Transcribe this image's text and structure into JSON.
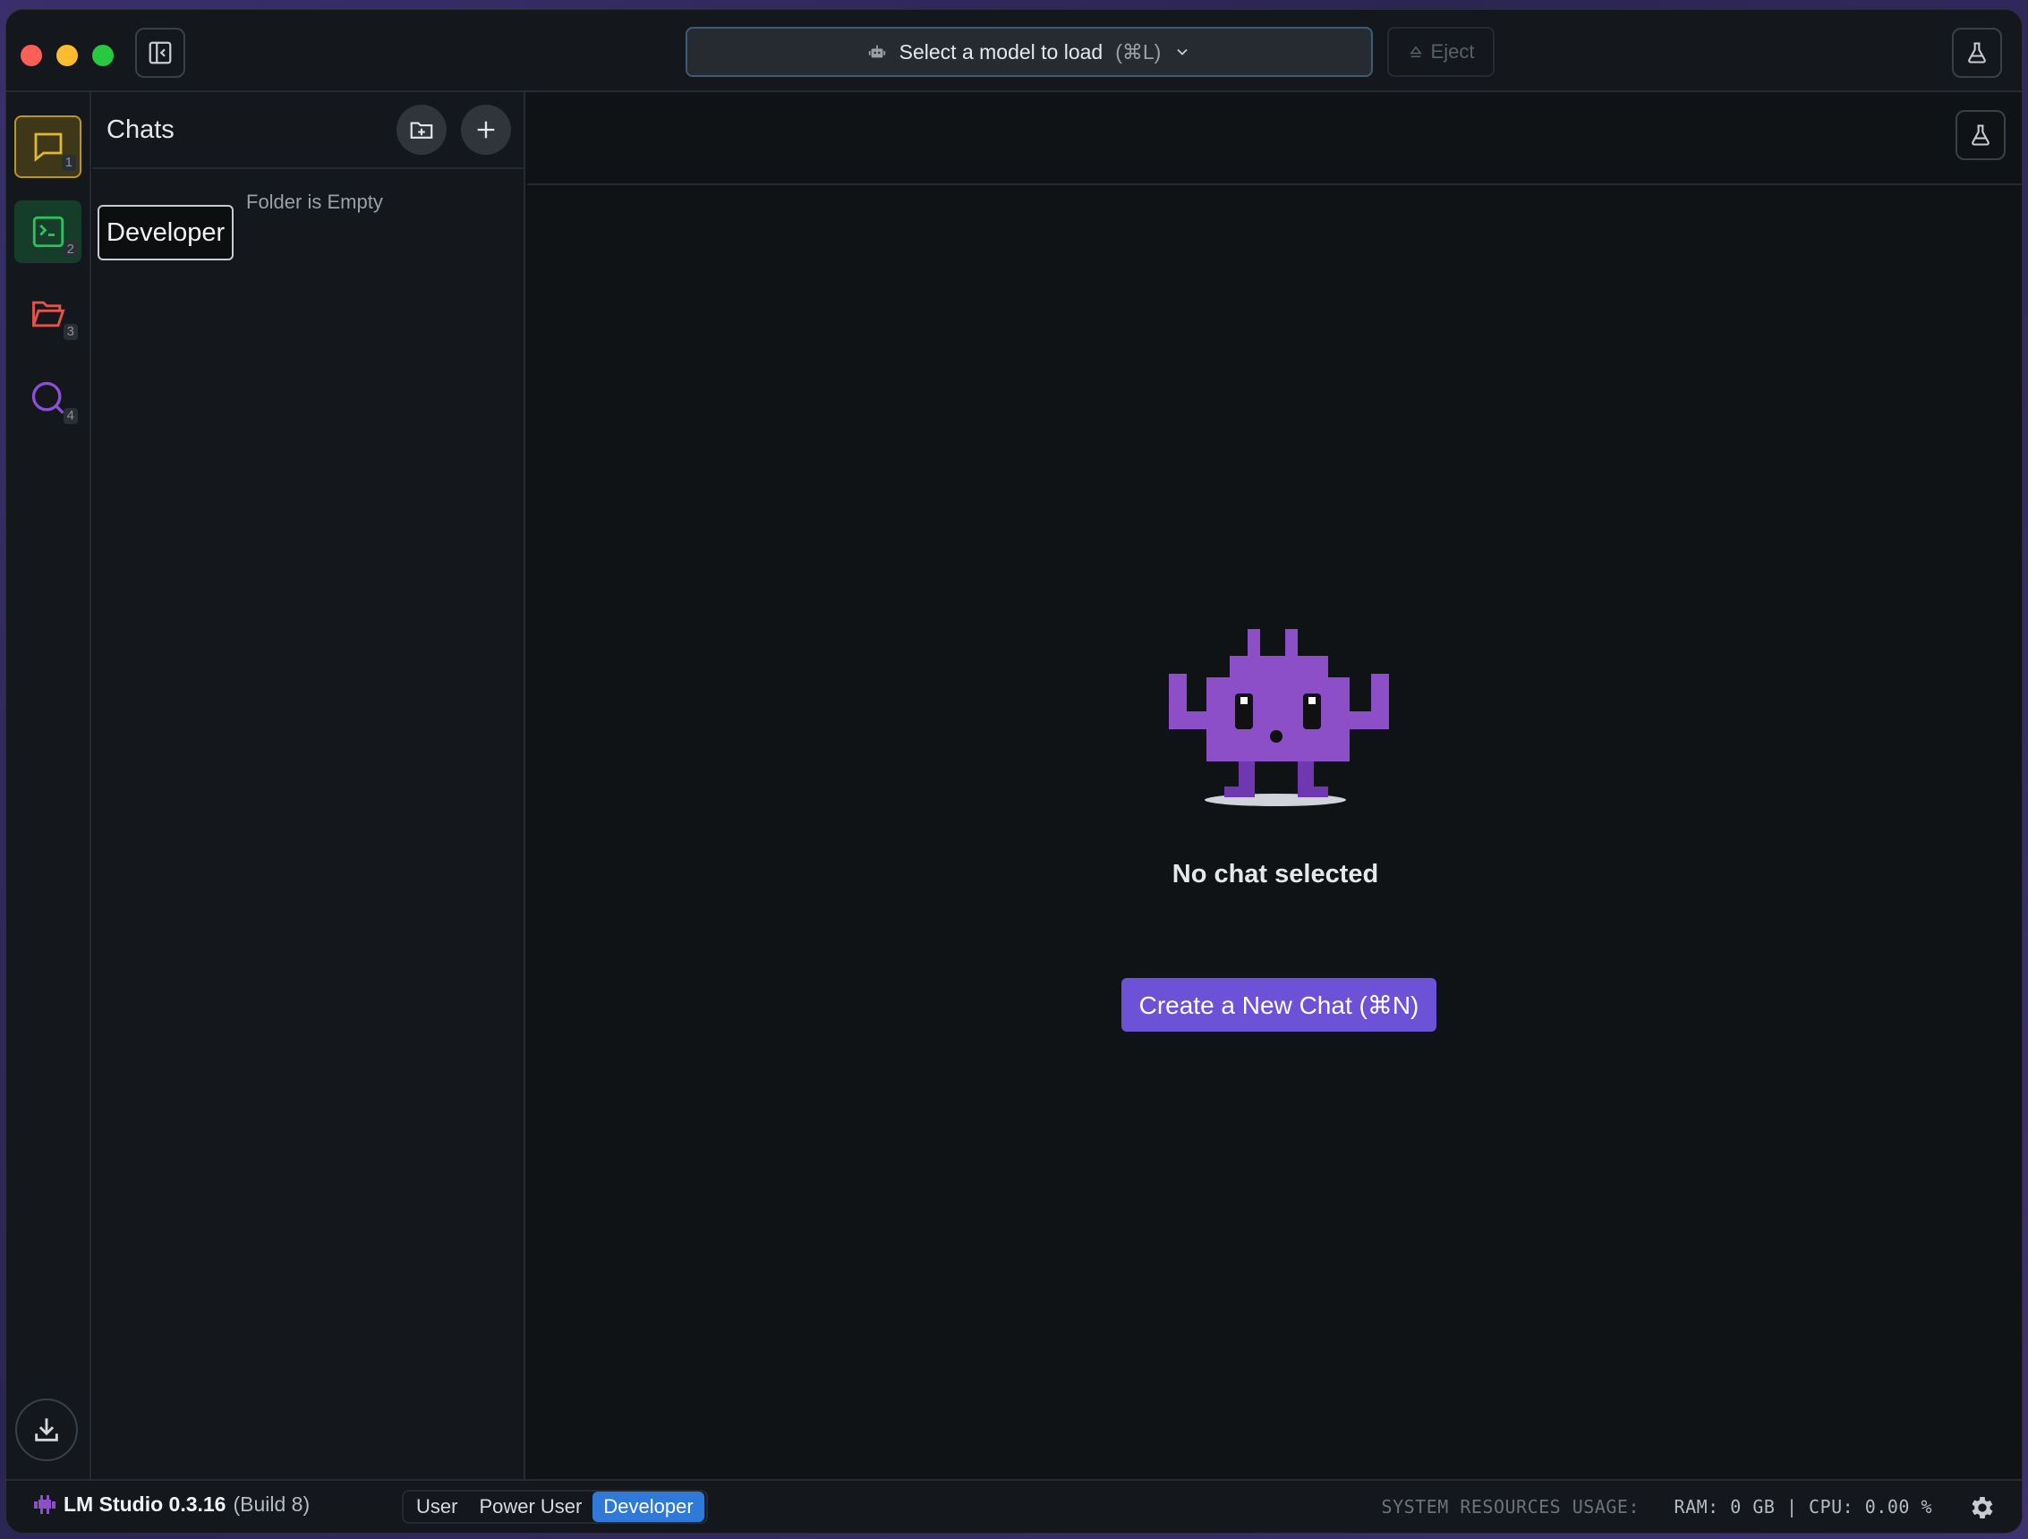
{
  "titlebar": {
    "model_select_label": "Select a model to load",
    "model_select_shortcut": "(⌘L)",
    "eject_label": "Eject"
  },
  "rail": {
    "items": [
      {
        "name": "chat",
        "number": "1",
        "color": "#e1b833"
      },
      {
        "name": "developer",
        "number": "2",
        "color": "#2fc15d"
      },
      {
        "name": "my-models",
        "number": "3",
        "color": "#e0544a"
      },
      {
        "name": "search",
        "number": "4",
        "color": "#8c4fd8"
      }
    ]
  },
  "chats_panel": {
    "title": "Chats",
    "empty_text": "Folder is Empty",
    "tooltip": "Developer"
  },
  "main": {
    "empty_title": "No chat selected",
    "create_button": "Create a New Chat (⌘N)"
  },
  "statusbar": {
    "app_name": "LM Studio 0.3.16",
    "build": "(Build 8)",
    "modes": [
      "User",
      "Power User",
      "Developer"
    ],
    "active_mode": "Developer",
    "resources_label": "SYSTEM RESOURCES USAGE:",
    "resources_value": "RAM: 0 GB | CPU: 0.00 %"
  },
  "colors": {
    "accent_purple": "#6b52d6",
    "mode_active": "#2f7ad8",
    "mascot": "#8c4fc8"
  }
}
